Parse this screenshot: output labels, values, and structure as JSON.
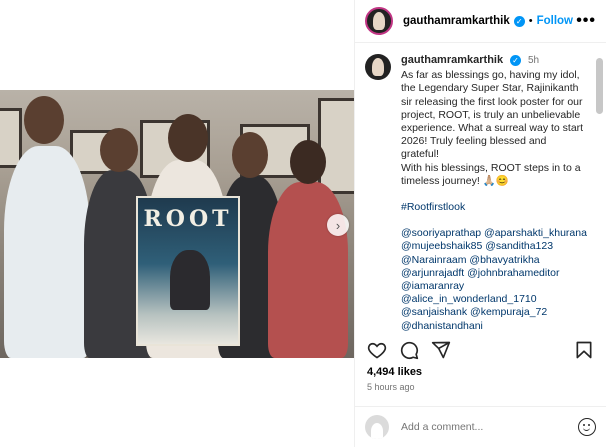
{
  "post": {
    "username": "gauthamramkarthik",
    "follow_label": "Follow",
    "separator": "•",
    "more_label": "•••",
    "verified_glyph": "✓"
  },
  "caption": {
    "username": "gauthamramkarthik",
    "time": "5h",
    "text": "As far as blessings go, having my idol, the Legendary Super Star, Rajinikanth sir releasing the first look poster for our project, ROOT, is truly an unbelievable experience. What a surreal way to start 2026! Truly feeling blessed and grateful!",
    "text2": "With his blessings, ROOT steps in to a timeless journey! 🙏🏼😊",
    "hashtag": "#Rootfirstlook",
    "mentions": [
      "@sooriyaprathap @aparshakti_khurana",
      "@mujeebshaik85 @sanditha123",
      "@Narainraam @bhavyatrikha",
      "@arjunrajadft @johnbrahameditor",
      "@iamaranray",
      "@alice_in_wonderland_1710",
      "@sanjaishank @kempuraja_72",
      "@dhanistandhani"
    ]
  },
  "photo": {
    "poster_title": "ROOT",
    "next_arrow": "›"
  },
  "engagement": {
    "likes": "4,494 likes",
    "time_ago": "5 hours ago"
  },
  "comment_box": {
    "placeholder": "Add a comment..."
  },
  "colors": {
    "accent": "#0095f6",
    "link": "#00376b"
  }
}
